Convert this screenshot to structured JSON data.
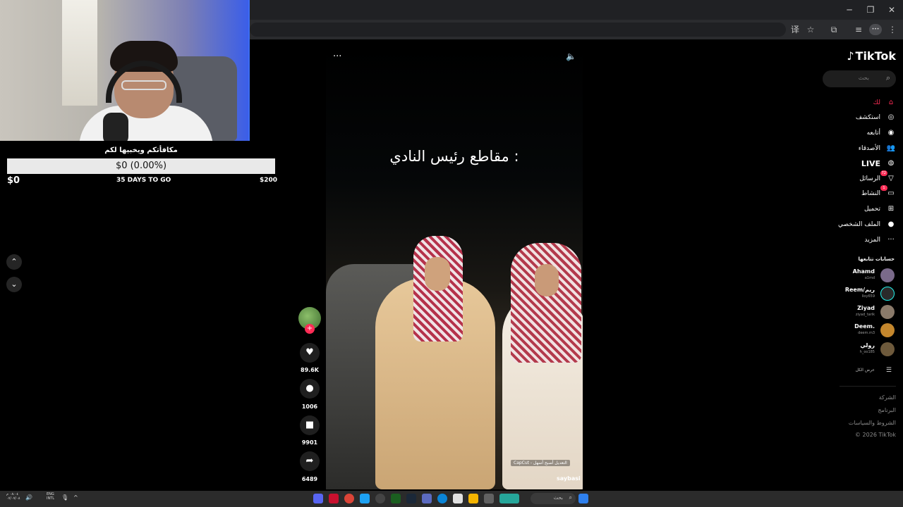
{
  "browser": {
    "minimize": "─",
    "restore": "❐",
    "close": "✕",
    "icons": [
      "translate-icon",
      "star-icon",
      "extensions-icon",
      "reading-list-icon",
      "profile-icon",
      "menu-icon"
    ],
    "translate_glyph": "译",
    "star_glyph": "☆",
    "ext_glyph": "⧉",
    "list_glyph": "≡",
    "menu_glyph": "⋮",
    "profile_text": "•••"
  },
  "donation": {
    "title": "مكافأتكم ويخبيها لكم",
    "amount_text": "$0 (0.00%)",
    "progress_fraction": 0,
    "current": "$0",
    "days_left": "35 DAYS TO GO",
    "goal": "$200",
    "fill_color": "#2bbf5b"
  },
  "nav": {
    "up": "⌃",
    "down": "⌄"
  },
  "video": {
    "caption": "مقاطع رئيس النادي :",
    "more": "···",
    "sound": "🔈",
    "capcut": "CapCut - التعديل أصبح أسهل",
    "watermark": "saybasi"
  },
  "actions": {
    "follow": "+",
    "like_glyph": "♥",
    "like_count": "89.6K",
    "comment_glyph": "●",
    "comment_count": "1006",
    "save_glyph": "■",
    "save_count": "9901",
    "share_glyph": "➦",
    "share_count": "6489"
  },
  "tiktok": {
    "logo": "TikTok",
    "logo_mark": "♪",
    "search_placeholder": "بحث",
    "search_glyph": "⌕",
    "accent": "#fe2c55",
    "menu": [
      {
        "label": "لك",
        "glyph": "⌂",
        "icon": "home-icon"
      },
      {
        "label": "استكشف",
        "glyph": "◎",
        "icon": "compass-icon"
      },
      {
        "label": "أتابعه",
        "glyph": "◉",
        "icon": "following-icon"
      },
      {
        "label": "الأصدقاء",
        "glyph": "👥",
        "icon": "friends-icon"
      },
      {
        "label": "LIVE",
        "glyph": "◍",
        "icon": "live-icon"
      },
      {
        "label": "الرسائل",
        "glyph": "▽",
        "icon": "messages-icon",
        "badge": "72"
      },
      {
        "label": "النشاط",
        "glyph": "▭",
        "icon": "activity-icon",
        "badge": "1"
      },
      {
        "label": "تحميل",
        "glyph": "⊞",
        "icon": "upload-icon"
      },
      {
        "label": "الملف الشخصي",
        "glyph": "●",
        "icon": "profile-icon"
      },
      {
        "label": "المزيد",
        "glyph": "···",
        "icon": "more-icon"
      }
    ],
    "following_title": "حسابات تتابعها",
    "accounts": [
      {
        "name": "Ahamd",
        "handle": "a1md"
      },
      {
        "name": "Reem/ريم",
        "handle": "lloy659"
      },
      {
        "name": "Ziyad",
        "handle": "ziyad_tarik"
      },
      {
        "name": "Deem.",
        "handle": "deem.m3"
      },
      {
        "name": "رولي",
        "handle": "h_oo185"
      }
    ],
    "see_all": "عرض الكل",
    "see_all_glyph": "☰",
    "footer": [
      "الشركة",
      "البرنامج",
      "الشروط والسياسات",
      "© 2026 TikTok"
    ]
  },
  "taskbar": {
    "time": "٠٨:٠٤ م",
    "date": "٠٧/٠٧/٠٨",
    "lang_top": "ENG",
    "lang_bottom": "INTL",
    "volume_glyph": "🔊",
    "mic_glyph": "🎙",
    "chevron_glyph": "^",
    "search_label": "بحث",
    "search_glyph": "⌕"
  }
}
